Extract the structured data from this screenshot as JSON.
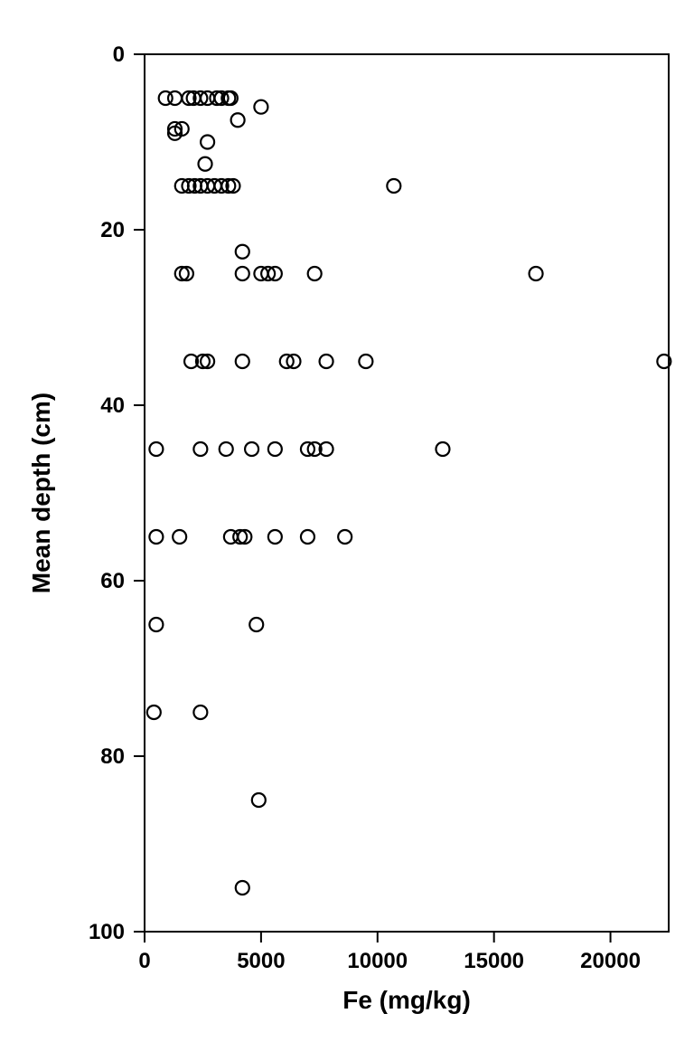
{
  "chart_data": {
    "type": "scatter",
    "xlabel": "Fe (mg/kg)",
    "ylabel": "Mean depth (cm)",
    "xlim": [
      0,
      22500
    ],
    "ylim": [
      100,
      0
    ],
    "xticks": [
      0,
      5000,
      10000,
      15000,
      20000
    ],
    "yticks": [
      0,
      20,
      40,
      60,
      80,
      100
    ],
    "points": [
      {
        "x": 900,
        "y": 5
      },
      {
        "x": 1300,
        "y": 5
      },
      {
        "x": 1900,
        "y": 5
      },
      {
        "x": 2100,
        "y": 5
      },
      {
        "x": 2400,
        "y": 5
      },
      {
        "x": 2700,
        "y": 5
      },
      {
        "x": 3100,
        "y": 5
      },
      {
        "x": 3300,
        "y": 5
      },
      {
        "x": 3600,
        "y": 5
      },
      {
        "x": 3700,
        "y": 5
      },
      {
        "x": 5000,
        "y": 6
      },
      {
        "x": 4000,
        "y": 7.5
      },
      {
        "x": 1300,
        "y": 8.5
      },
      {
        "x": 1600,
        "y": 8.5
      },
      {
        "x": 1300,
        "y": 9
      },
      {
        "x": 2700,
        "y": 10
      },
      {
        "x": 2600,
        "y": 12.5
      },
      {
        "x": 1600,
        "y": 15
      },
      {
        "x": 1900,
        "y": 15
      },
      {
        "x": 2150,
        "y": 15
      },
      {
        "x": 2400,
        "y": 15
      },
      {
        "x": 2700,
        "y": 15
      },
      {
        "x": 3000,
        "y": 15
      },
      {
        "x": 3300,
        "y": 15
      },
      {
        "x": 3600,
        "y": 15
      },
      {
        "x": 3800,
        "y": 15
      },
      {
        "x": 10700,
        "y": 15
      },
      {
        "x": 4200,
        "y": 22.5
      },
      {
        "x": 1600,
        "y": 25
      },
      {
        "x": 1800,
        "y": 25
      },
      {
        "x": 4200,
        "y": 25
      },
      {
        "x": 5000,
        "y": 25
      },
      {
        "x": 5300,
        "y": 25
      },
      {
        "x": 5600,
        "y": 25
      },
      {
        "x": 7300,
        "y": 25
      },
      {
        "x": 16800,
        "y": 25
      },
      {
        "x": 2000,
        "y": 35
      },
      {
        "x": 2500,
        "y": 35
      },
      {
        "x": 2700,
        "y": 35
      },
      {
        "x": 4200,
        "y": 35
      },
      {
        "x": 6100,
        "y": 35
      },
      {
        "x": 6400,
        "y": 35
      },
      {
        "x": 7800,
        "y": 35
      },
      {
        "x": 9500,
        "y": 35
      },
      {
        "x": 22300,
        "y": 35
      },
      {
        "x": 500,
        "y": 45
      },
      {
        "x": 2400,
        "y": 45
      },
      {
        "x": 3500,
        "y": 45
      },
      {
        "x": 4600,
        "y": 45
      },
      {
        "x": 5600,
        "y": 45
      },
      {
        "x": 7000,
        "y": 45
      },
      {
        "x": 7300,
        "y": 45
      },
      {
        "x": 7800,
        "y": 45
      },
      {
        "x": 12800,
        "y": 45
      },
      {
        "x": 500,
        "y": 55
      },
      {
        "x": 1500,
        "y": 55
      },
      {
        "x": 3700,
        "y": 55
      },
      {
        "x": 4100,
        "y": 55
      },
      {
        "x": 4300,
        "y": 55
      },
      {
        "x": 5600,
        "y": 55
      },
      {
        "x": 7000,
        "y": 55
      },
      {
        "x": 8600,
        "y": 55
      },
      {
        "x": 500,
        "y": 65
      },
      {
        "x": 4800,
        "y": 65
      },
      {
        "x": 400,
        "y": 75
      },
      {
        "x": 2400,
        "y": 75
      },
      {
        "x": 4900,
        "y": 85
      },
      {
        "x": 4200,
        "y": 95
      }
    ]
  }
}
